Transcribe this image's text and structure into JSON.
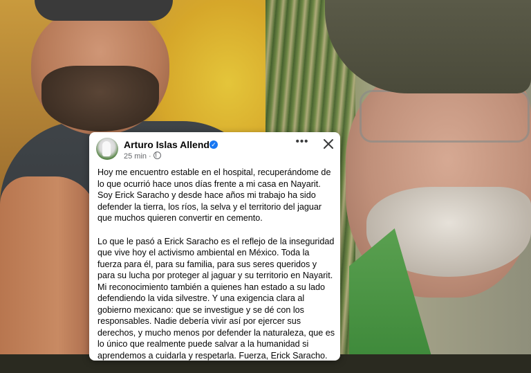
{
  "post": {
    "author": "Arturo Islas Allende",
    "time": "25 min",
    "more_label": "•••",
    "paragraph_1": "Hoy me encuentro estable en el hospital, recuperándome de lo que ocurrió hace unos días frente a mi casa en Nayarit. Soy Erick Saracho y desde hace años mi trabajo ha sido defender la tierra, los ríos, la selva y el territorio del jaguar que muchos quieren convertir en cemento.",
    "paragraph_2": "Lo que le pasó a Erick Saracho es el reflejo de la inseguridad que vive hoy el activismo ambiental en México. Toda la fuerza para él, para su familia, para sus seres queridos y para su lucha por proteger al jaguar y su territorio en Nayarit. Mi reconocimiento también a quienes han estado a su lado defendiendo la vida silvestre. Y una exigencia clara al gobierno mexicano: que se investigue y se dé con los responsables. Nadie debería vivir así por ejercer sus derechos, y mucho menos por defender la naturaleza, que es lo único que realmente puede salvar a la humanidad si aprendemos a cuidarla y respetarla. Fuerza, Erick Saracho."
  },
  "icons": {
    "verified": "verified-badge-icon",
    "privacy": "globe-icon",
    "close": "close-icon"
  },
  "colors": {
    "verified_blue": "#1877f2",
    "text": "#050505",
    "secondary_text": "#65676b"
  }
}
